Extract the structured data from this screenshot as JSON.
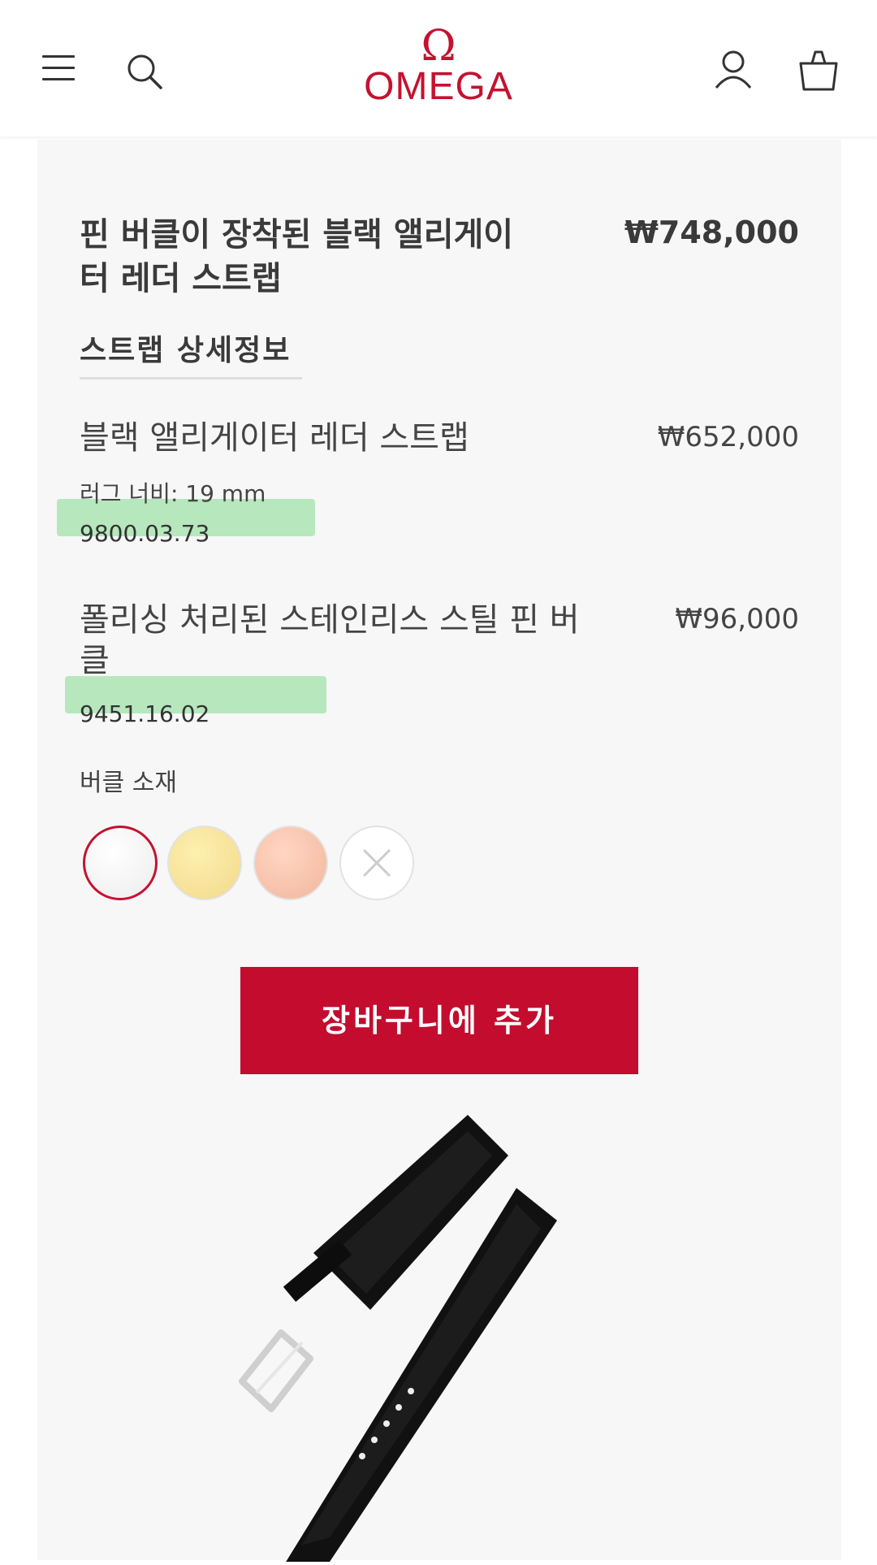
{
  "header": {
    "brand": "OMEGA",
    "brand_symbol": "Ω",
    "icons": [
      "menu-icon",
      "search-icon",
      "account-icon",
      "cart-icon"
    ],
    "brand_color": "#c41230"
  },
  "product": {
    "title": "핀 버클이 장착된 블랙 앨리게이터 레더 스트랩",
    "price": "₩748,000"
  },
  "details": {
    "section_title": "스트랩 상세정보",
    "items": [
      {
        "name": "블랙 앨리게이터 레더 스트랩",
        "price": "₩652,000",
        "lug_width": "러그 너비: 19 mm",
        "code": "9800.03.73"
      },
      {
        "name": "폴리싱 처리된 스테인리스 스틸 핀 버클",
        "price": "₩96,000",
        "code": "9451.16.02"
      }
    ]
  },
  "buckle": {
    "label": "버클 소재",
    "options": [
      {
        "name": "steel",
        "color": "#f2f2f2",
        "selected": true
      },
      {
        "name": "yellow-gold",
        "color": "#f6e09a",
        "selected": false
      },
      {
        "name": "rose-gold",
        "color": "#f7c2a8",
        "selected": false
      },
      {
        "name": "none",
        "color": "#ffffff",
        "selected": false
      }
    ]
  },
  "actions": {
    "add_to_cart": "장바구니에 추가",
    "button_color": "#c40c2e"
  },
  "image": {
    "subject": "black alligator leather strap with pin buckle"
  }
}
